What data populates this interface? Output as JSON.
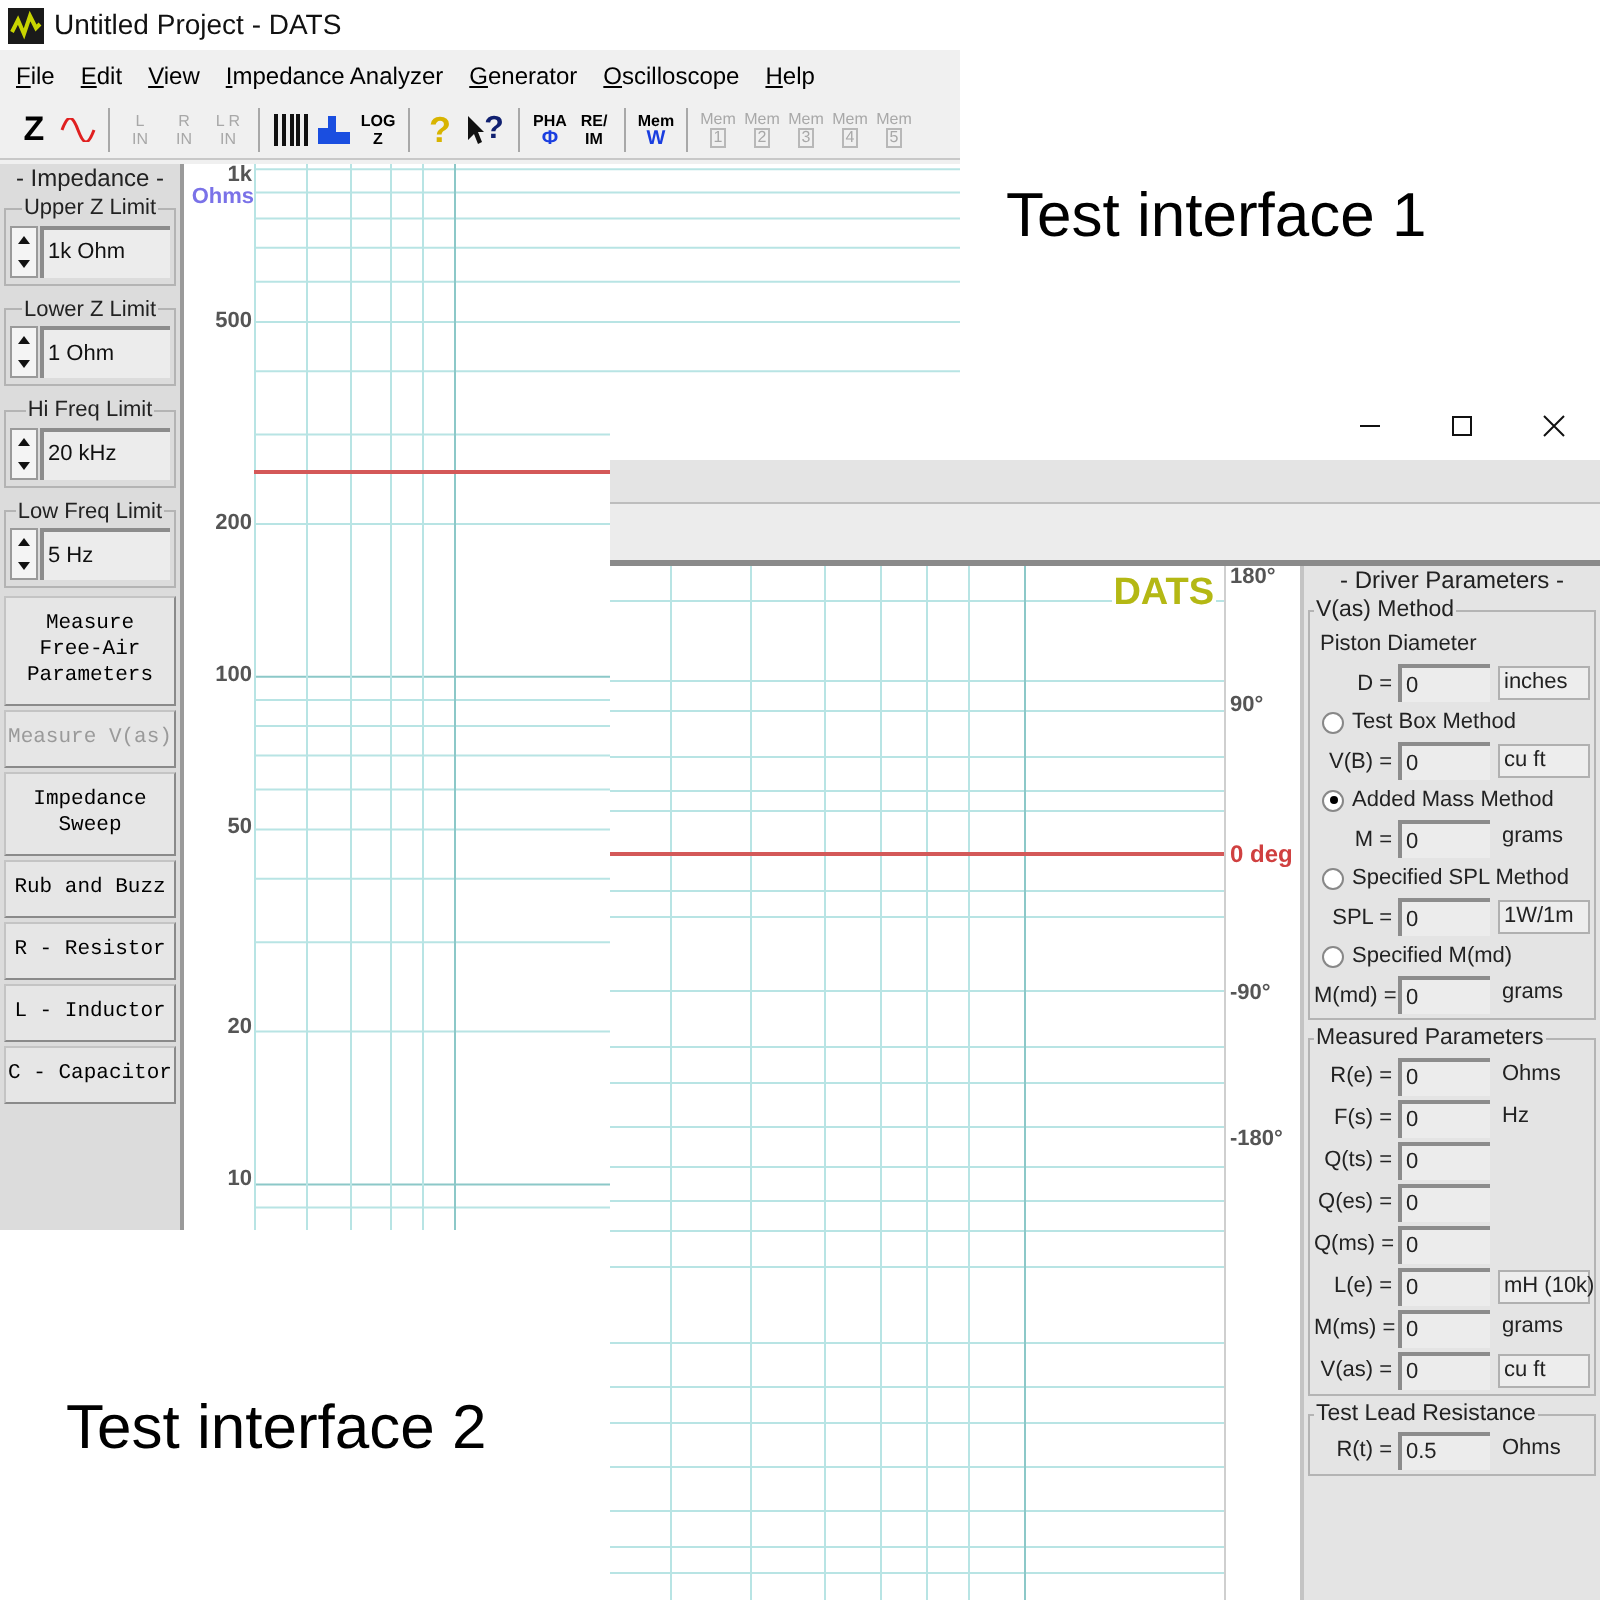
{
  "window_1": {
    "title": "Untitled Project - DATS",
    "menu": [
      "File",
      "Edit",
      "View",
      "Impedance Analyzer",
      "Generator",
      "Oscilloscope",
      "Help"
    ],
    "toolbar": [
      {
        "kind": "big",
        "label": "Z"
      },
      {
        "kind": "wave"
      },
      {
        "kind": "separator"
      },
      {
        "kind": "text",
        "lines": [
          "L",
          "IN"
        ],
        "disabled": true
      },
      {
        "kind": "text",
        "lines": [
          "R",
          "IN"
        ],
        "disabled": true
      },
      {
        "kind": "text",
        "lines": [
          "L R",
          "IN"
        ],
        "disabled": true
      },
      {
        "kind": "separator"
      },
      {
        "kind": "keys"
      },
      {
        "kind": "bars"
      },
      {
        "kind": "text",
        "lines": [
          "LOG",
          "Z"
        ],
        "disabled": false
      },
      {
        "kind": "separator"
      },
      {
        "kind": "help",
        "label": "?"
      },
      {
        "kind": "pointer",
        "label": "?"
      },
      {
        "kind": "separator"
      },
      {
        "kind": "text",
        "lines": [
          "PHA",
          "Φ"
        ],
        "disabled": false,
        "accent": true
      },
      {
        "kind": "text",
        "lines": [
          "RE/",
          "IM"
        ],
        "disabled": false
      },
      {
        "kind": "separator"
      },
      {
        "kind": "text",
        "lines": [
          "Mem",
          "W"
        ],
        "disabled": false,
        "accent": true
      },
      {
        "kind": "separator"
      },
      {
        "kind": "slot",
        "lines": [
          "Mem",
          "1"
        ],
        "disabled": true
      },
      {
        "kind": "slot",
        "lines": [
          "Mem",
          "2"
        ],
        "disabled": true
      },
      {
        "kind": "slot",
        "lines": [
          "Mem",
          "3"
        ],
        "disabled": true
      },
      {
        "kind": "slot",
        "lines": [
          "Mem",
          "4"
        ],
        "disabled": true
      },
      {
        "kind": "slot",
        "lines": [
          "Mem",
          "5"
        ],
        "disabled": true
      }
    ],
    "side_panel": {
      "heading": "- Impedance -",
      "limits": [
        {
          "legend": "Upper Z Limit",
          "value": "1k Ohm"
        },
        {
          "legend": "Lower Z Limit",
          "value": "1 Ohm"
        },
        {
          "legend": "Hi Freq Limit",
          "value": "20 kHz"
        },
        {
          "legend": "Low Freq Limit",
          "value": "5 Hz"
        }
      ],
      "buttons": [
        {
          "label": "Measure\nFree-Air\nParameters",
          "disabled": false
        },
        {
          "label": "Measure V(as)",
          "disabled": true
        },
        {
          "label": "Impedance\nSweep",
          "disabled": false
        },
        {
          "label": "Rub and Buzz",
          "disabled": false
        },
        {
          "label": "R - Resistor",
          "disabled": false
        },
        {
          "label": "L - Inductor",
          "disabled": false
        },
        {
          "label": "C - Capacitor",
          "disabled": false
        }
      ]
    },
    "graph": {
      "unit": "Ohms",
      "y_labels": [
        "1k",
        "500",
        "200",
        "100",
        "50",
        "20",
        "10"
      ]
    }
  },
  "window_2": {
    "graph": {
      "logo": "DATS",
      "y_labels": [
        {
          "text": "180°",
          "kind": "normal"
        },
        {
          "text": "90°",
          "kind": "normal"
        },
        {
          "text": "0 deg",
          "kind": "reference"
        },
        {
          "text": "-90°",
          "kind": "normal"
        },
        {
          "text": "-180°",
          "kind": "normal"
        }
      ]
    },
    "driver_panel": {
      "heading": "- Driver Parameters -",
      "sections": [
        {
          "title": "V(as) Method",
          "items": [
            {
              "kind": "label",
              "text": "Piston Diameter"
            },
            {
              "kind": "field",
              "label": "D =",
              "value": "0",
              "unit": "inches",
              "unit_boxed": true
            },
            {
              "kind": "radio",
              "label": "Test Box Method",
              "selected": false
            },
            {
              "kind": "field",
              "label": "V(B) =",
              "value": "0",
              "unit": "cu ft",
              "unit_boxed": true
            },
            {
              "kind": "radio",
              "label": "Added Mass Method",
              "selected": true
            },
            {
              "kind": "field",
              "label": "M =",
              "value": "0",
              "unit": "grams",
              "unit_boxed": false
            },
            {
              "kind": "radio",
              "label": "Specified SPL Method",
              "selected": false
            },
            {
              "kind": "field",
              "label": "SPL =",
              "value": "0",
              "unit": "1W/1m",
              "unit_boxed": true
            },
            {
              "kind": "radio",
              "label": "Specified M(md)",
              "selected": false
            },
            {
              "kind": "field",
              "label": "M(md) =",
              "value": "0",
              "unit": "grams",
              "unit_boxed": false
            }
          ]
        },
        {
          "title": "Measured Parameters",
          "items": [
            {
              "kind": "field",
              "label": "R(e) =",
              "value": "0",
              "unit": "Ohms",
              "unit_boxed": false
            },
            {
              "kind": "field",
              "label": "F(s) =",
              "value": "0",
              "unit": "Hz",
              "unit_boxed": false
            },
            {
              "kind": "field",
              "label": "Q(ts) =",
              "value": "0"
            },
            {
              "kind": "field",
              "label": "Q(es) =",
              "value": "0"
            },
            {
              "kind": "field",
              "label": "Q(ms) =",
              "value": "0"
            },
            {
              "kind": "field",
              "label": "L(e) =",
              "value": "0",
              "unit": "mH (10k)",
              "unit_boxed": true
            },
            {
              "kind": "field",
              "label": "M(ms) =",
              "value": "0",
              "unit": "grams",
              "unit_boxed": false
            },
            {
              "kind": "field",
              "label": "V(as) =",
              "value": "0",
              "unit": "cu ft",
              "unit_boxed": true
            }
          ]
        },
        {
          "title": "Test Lead Resistance",
          "items": [
            {
              "kind": "field",
              "label": "R(t) =",
              "value": "0.5",
              "unit": "Ohms",
              "unit_boxed": false
            }
          ]
        }
      ]
    }
  },
  "captions": [
    "Test interface 1",
    "Test interface 2"
  ]
}
